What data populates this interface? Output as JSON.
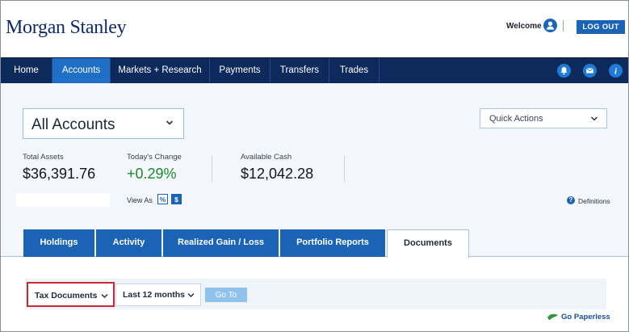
{
  "header": {
    "brand": "Morgan Stanley",
    "welcome": "Welcome",
    "logout_label": "LOG OUT"
  },
  "nav": {
    "items": [
      {
        "label": "Home",
        "active": false
      },
      {
        "label": "Accounts",
        "active": true
      },
      {
        "label": "Markets + Research",
        "active": false
      },
      {
        "label": "Payments",
        "active": false
      },
      {
        "label": "Transfers",
        "active": false
      },
      {
        "label": "Trades",
        "active": false
      }
    ],
    "icons": [
      "bell-icon",
      "mail-icon",
      "info-icon"
    ],
    "info_glyph": "i"
  },
  "account": {
    "selected": "All Accounts",
    "quick_actions": "Quick Actions"
  },
  "stats": {
    "total_assets_label": "Total Assets",
    "total_assets_value": "$36,391.76",
    "todays_change_label": "Today's Change",
    "todays_change_value": "+0.29%",
    "available_cash_label": "Available Cash",
    "available_cash_value": "$12,042.28"
  },
  "view_as": {
    "label": "View As",
    "percent": "%",
    "dollar": "$"
  },
  "definitions": {
    "label": "Definitions",
    "glyph": "?"
  },
  "tabs": [
    {
      "label": "Holdings",
      "active": false
    },
    {
      "label": "Activity",
      "active": false
    },
    {
      "label": "Realized Gain / Loss",
      "active": false
    },
    {
      "label": "Portfolio Reports",
      "active": false
    },
    {
      "label": "Documents",
      "active": true
    }
  ],
  "filters": {
    "document_type": "Tax Documents",
    "date_range": "Last 12 months",
    "go_to_label": "Go To"
  },
  "paperless": {
    "label": "Go Paperless"
  },
  "colors": {
    "nav_bg": "#0e2a5c",
    "accent": "#1a63b5",
    "active_nav": "#1e6fc5",
    "positive": "#1b8a2c",
    "highlight_border": "#c62a35"
  }
}
